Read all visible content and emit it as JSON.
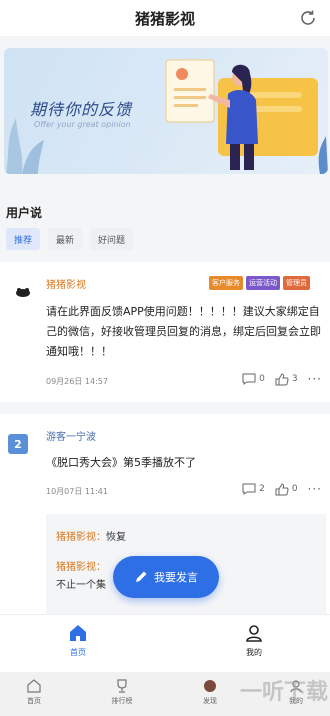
{
  "header": {
    "title": "猪猪影视",
    "refresh_icon": "refresh-icon"
  },
  "banner": {
    "title": "期待你的反馈",
    "subtitle": "Offer your great opinion"
  },
  "section": {
    "title": "用户说"
  },
  "tabs": [
    {
      "label": "推荐",
      "active": true
    },
    {
      "label": "最新",
      "active": false
    },
    {
      "label": "好问题",
      "active": false
    }
  ],
  "posts": [
    {
      "author": "猪猪影视",
      "badges": [
        {
          "label": "客户服务",
          "color": "#e8892a"
        },
        {
          "label": "运营活动",
          "color": "#7b58c9"
        },
        {
          "label": "管理员",
          "color": "#e06a3c"
        }
      ],
      "content": "请在此界面反馈APP使用问题！！！！！建议大家绑定自己的微信，好接收管理员回复的消息，绑定后回复会立即通知哦！！！",
      "time": "09月26日 14:57",
      "comments": "0",
      "likes": "3"
    },
    {
      "author": "游客一宁波",
      "avatar_text": "2",
      "content": "《脱口秀大会》第5季播放不了",
      "time": "10月07日 11:41",
      "comments": "2",
      "likes": "0",
      "replies": [
        {
          "name": "猪猪影视：",
          "text": "恢复"
        },
        {
          "name": "猪猪影视：",
          "text": ""
        },
        {
          "name": "",
          "text": "不止一个集"
        }
      ]
    }
  ],
  "fab": {
    "label": "我要发言"
  },
  "bottom_nav": [
    {
      "label": "首页",
      "active": true
    },
    {
      "label": "我的",
      "active": false
    }
  ],
  "system_nav": [
    {
      "label": "首页"
    },
    {
      "label": "排行榜"
    },
    {
      "label": "发现"
    },
    {
      "label": "我的"
    }
  ],
  "watermark": "一听下载",
  "colors": {
    "accent": "#2f6fe6",
    "author_orange": "#d9781e"
  }
}
